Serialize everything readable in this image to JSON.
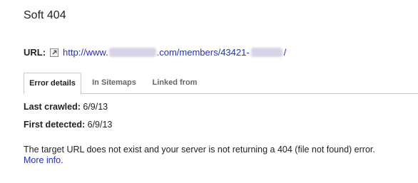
{
  "page": {
    "title": "Soft 404"
  },
  "url": {
    "label": "URL:",
    "icon": "external-link-icon",
    "prefix": "http://www.",
    "middle": ".com/members/43421-",
    "suffix": "/"
  },
  "tabs": [
    {
      "label": "Error details",
      "active": true
    },
    {
      "label": "In Sitemaps",
      "active": false
    },
    {
      "label": "Linked from",
      "active": false
    }
  ],
  "details": {
    "last_crawled_label": "Last crawled:",
    "last_crawled_value": "6/9/13",
    "first_detected_label": "First detected:",
    "first_detected_value": "6/9/13"
  },
  "description": "The target URL does not exist and your server is not returning a 404 (file not found) error.",
  "more_info": "More info.",
  "colors": {
    "link": "#1f2fd0",
    "text": "#222222",
    "tab_border": "#c8c8c8"
  }
}
